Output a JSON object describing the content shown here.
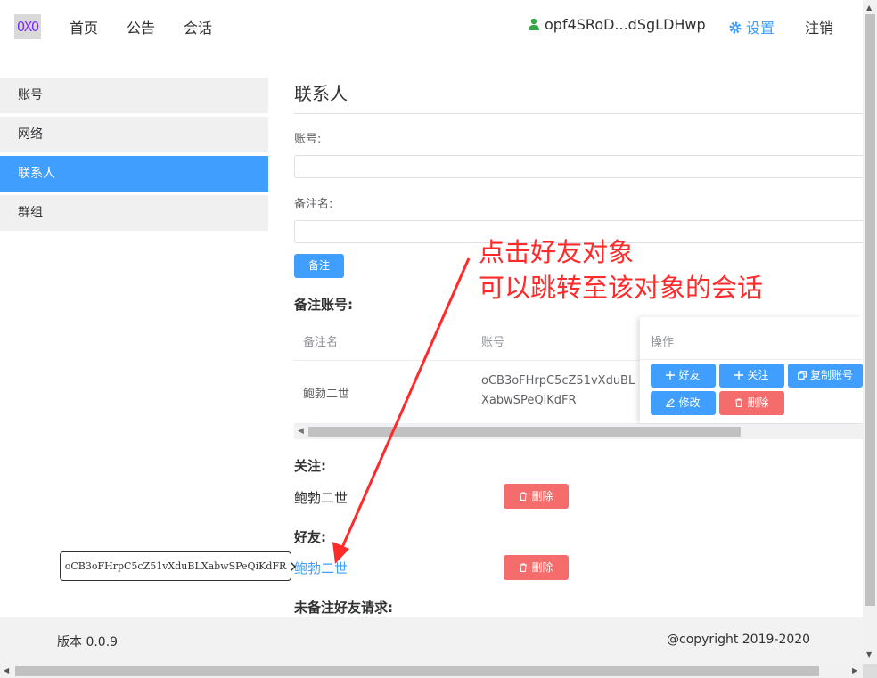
{
  "navbar": {
    "logo": "OXO",
    "links": [
      "首页",
      "公告",
      "会话"
    ],
    "user": "opf4SRoD...dSgLDHwp",
    "settings": "设置",
    "logout": "注销"
  },
  "sidebar": {
    "items": [
      {
        "label": "账号"
      },
      {
        "label": "网络"
      },
      {
        "label": "联系人",
        "active": true
      },
      {
        "label": "群组"
      }
    ]
  },
  "main": {
    "title": "联系人",
    "account_label": "账号:",
    "account_value": "",
    "remark_label": "备注名:",
    "remark_value": "",
    "remark_button": "备注",
    "remarked_section": "备注账号:",
    "table": {
      "headers": [
        "备注名",
        "账号",
        "操作"
      ],
      "rows": [
        {
          "remark": "鲍勃二世",
          "account_line1": "oCB3oFHrpC5cZ51vXduBL",
          "account_line2": "XabwSPeQiKdFR"
        }
      ],
      "actions": [
        "好友",
        "关注",
        "复制账号",
        "修改",
        "删除"
      ]
    },
    "follow_section": "关注:",
    "follow_name": "鲍勃二世",
    "follow_delete": "删除",
    "friends_section": "好友:",
    "friend_name": "鲍勃二世",
    "friend_delete": "删除",
    "pending_section": "未备注好友请求:",
    "tooltip": "oCB3oFHrpC5cZ51vXduBLXabwSPeQiKdFR"
  },
  "annotation": {
    "line1": "点击好友对象",
    "line2": "可以跳转至该对象的会话",
    "color": "#ff2a2a"
  },
  "footer": {
    "version": "版本 0.0.9",
    "copyright": "@copyright 2019-2020"
  },
  "colors": {
    "accent": "#409eff",
    "danger": "#f56c6c"
  }
}
